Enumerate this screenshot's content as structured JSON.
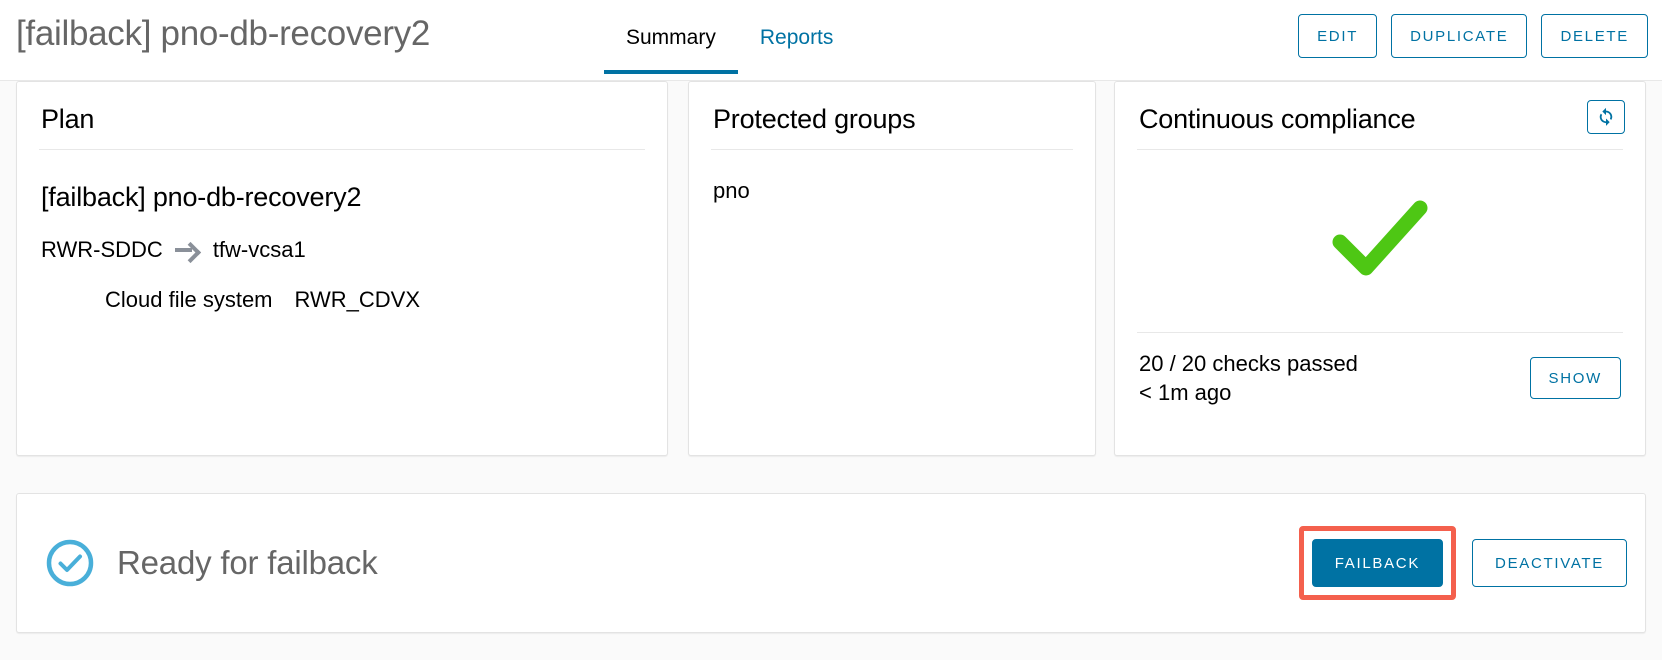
{
  "header": {
    "title": "[failback] pno-db-recovery2",
    "tabs": [
      {
        "label": "Summary",
        "active": true
      },
      {
        "label": "Reports",
        "active": false
      }
    ],
    "actions": {
      "edit": "EDIT",
      "duplicate": "DUPLICATE",
      "delete": "DELETE"
    }
  },
  "plan_card": {
    "title": "Plan",
    "plan_name": "[failback] pno-db-recovery2",
    "source": "RWR-SDDC",
    "target": "tfw-vcsa1",
    "detail_label": "Cloud file system",
    "detail_value": "RWR_CDVX"
  },
  "protected_groups_card": {
    "title": "Protected groups",
    "groups": [
      "pno"
    ]
  },
  "compliance_card": {
    "title": "Continuous compliance",
    "refresh_icon": "refresh-icon",
    "status_icon": "green-check-icon",
    "checks_summary": "20 / 20 checks passed",
    "checks_time": "< 1m ago",
    "show_label": "SHOW"
  },
  "status_bar": {
    "icon": "check-circle-icon",
    "text": "Ready for failback",
    "failback_label": "FAILBACK",
    "deactivate_label": "DEACTIVATE",
    "highlight_color": "#f4604d"
  },
  "colors": {
    "accent": "#0072a3",
    "success_green": "#4ec714",
    "status_blue": "#49afd9",
    "page_bg": "#fafafa",
    "card_bg": "#ffffff"
  }
}
